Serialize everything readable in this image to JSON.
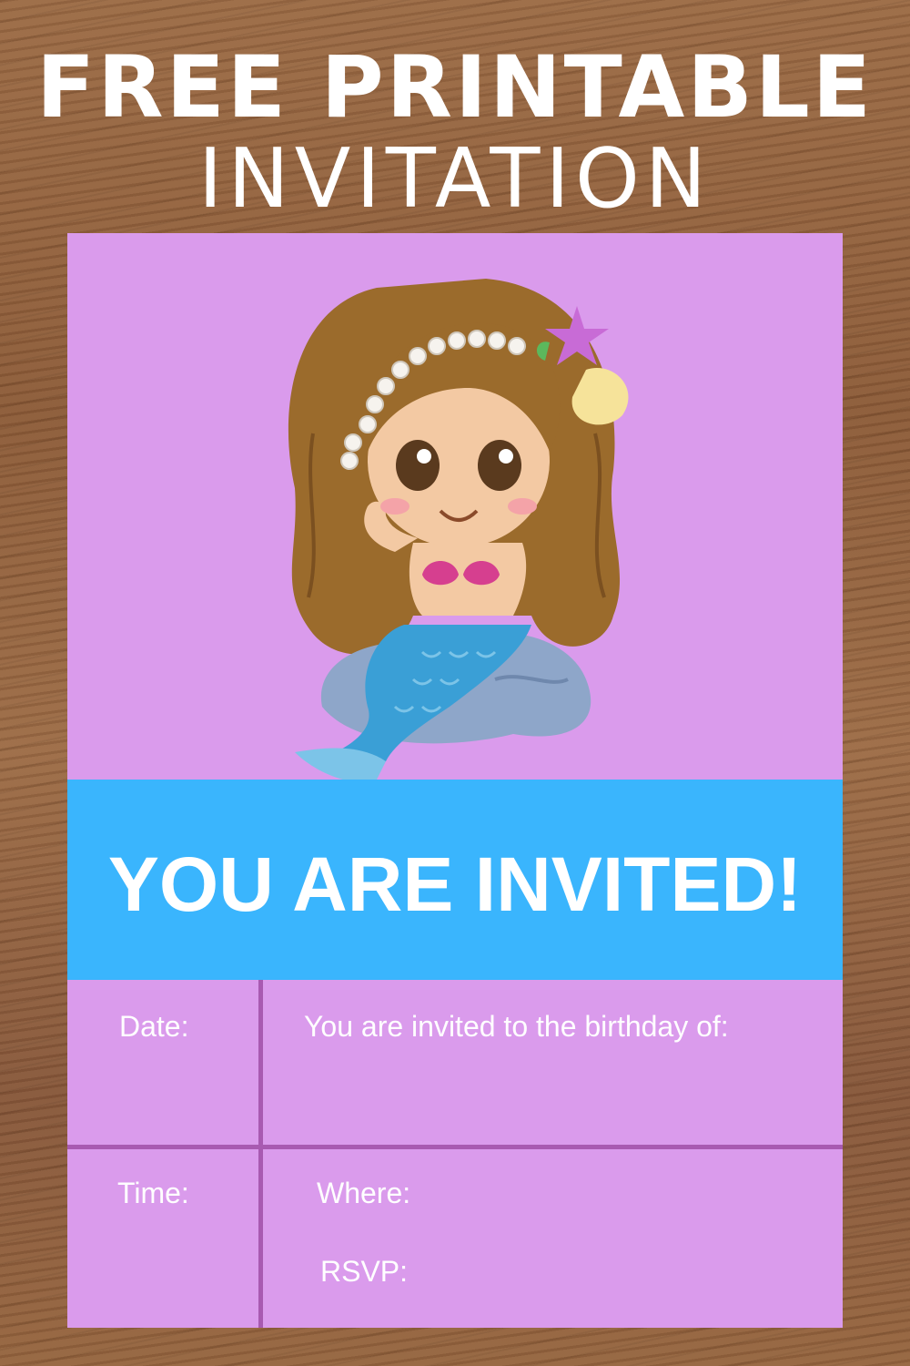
{
  "header": {
    "line1": "FREE PRINTABLE",
    "line2": "INVITATION"
  },
  "invitation": {
    "banner": "YOU ARE INVITED!",
    "date_label": "Date:",
    "birthday_label": "You are invited to the birthday of:",
    "time_label": "Time:",
    "where_label": "Where:",
    "rsvp_label": "RSVP:"
  },
  "colors": {
    "card_background": "#da9bec",
    "banner_background": "#3ab5fd",
    "divider": "#a85ab1",
    "text": "#ffffff"
  },
  "illustration": "mermaid-girl-on-rock"
}
